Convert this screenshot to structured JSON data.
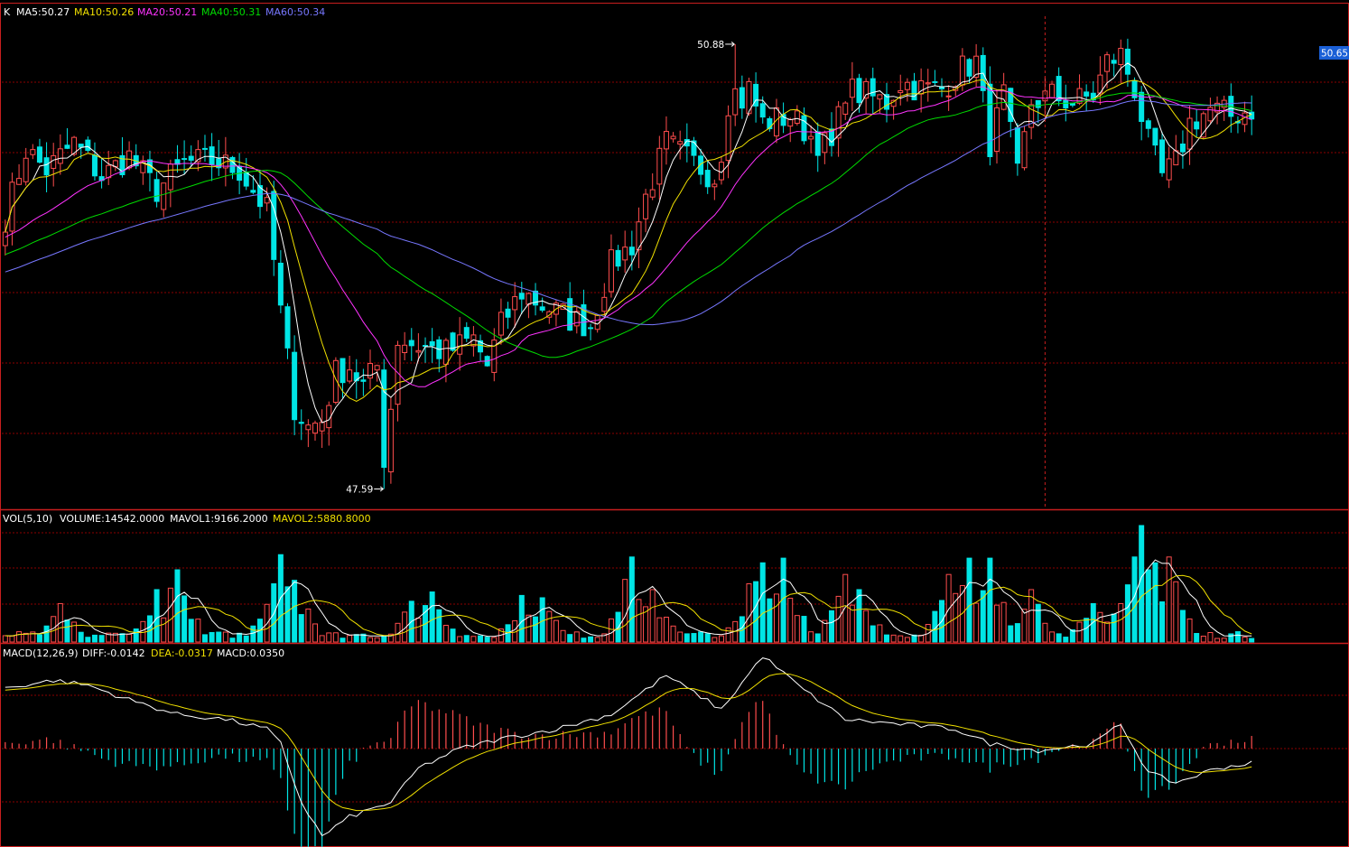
{
  "colors": {
    "up": "#ff4d4d",
    "down": "#00e5e5",
    "ma5": "#ffffff",
    "ma10": "#f0e000",
    "ma20": "#ff33ff",
    "ma40": "#00dd00",
    "ma60": "#7777ff",
    "grid": "#8b0000",
    "frame": "#c81e1e",
    "dea": "#f0e000",
    "diff": "#ffffff",
    "priceTagBg": "#1a5fd6"
  },
  "kline": {
    "prefix": "K",
    "ma5": "MA5:50.27",
    "ma10": "MA10:50.26",
    "ma20": "MA20:50.21",
    "ma40": "MA40:50.31",
    "ma60": "MA60:50.34",
    "high_label": "50.88",
    "low_label": "47.59",
    "price_tag": "50.65"
  },
  "volume": {
    "title": "VOL(5,10)",
    "volume": "VOLUME:14542.0000",
    "mavol1": "MAVOL1:9166.2000",
    "mavol2": "MAVOL2:5880.8000"
  },
  "macd": {
    "title": "MACD(12,26,9)",
    "diff": "DIFF:-0.0142",
    "dea": "DEA:-0.0317",
    "macd": "MACD:0.0350"
  },
  "chart_data": {
    "type": "candlestick",
    "price_range": [
      47.5,
      51.1
    ],
    "high": 50.88,
    "low": 47.59,
    "last": 50.65,
    "close_anchors": [
      [
        0,
        49.6
      ],
      [
        3,
        50.1
      ],
      [
        6,
        49.95
      ],
      [
        10,
        50.15
      ],
      [
        14,
        49.9
      ],
      [
        18,
        50.05
      ],
      [
        22,
        49.8
      ],
      [
        26,
        50.0
      ],
      [
        30,
        50.02
      ],
      [
        34,
        49.95
      ],
      [
        38,
        49.65
      ],
      [
        40,
        48.9
      ],
      [
        42,
        48.2
      ],
      [
        44,
        48.05
      ],
      [
        46,
        48.1
      ],
      [
        48,
        48.45
      ],
      [
        50,
        48.5
      ],
      [
        52,
        48.35
      ],
      [
        54,
        48.5
      ],
      [
        55,
        47.7
      ],
      [
        57,
        48.7
      ],
      [
        60,
        48.65
      ],
      [
        64,
        48.6
      ],
      [
        68,
        48.7
      ],
      [
        70,
        48.5
      ],
      [
        72,
        48.8
      ],
      [
        75,
        49.05
      ],
      [
        78,
        48.95
      ],
      [
        82,
        48.85
      ],
      [
        85,
        48.8
      ],
      [
        88,
        49.25
      ],
      [
        91,
        49.4
      ],
      [
        93,
        49.75
      ],
      [
        96,
        50.15
      ],
      [
        100,
        50.0
      ],
      [
        103,
        49.9
      ],
      [
        105,
        50.3
      ],
      [
        108,
        50.55
      ],
      [
        110,
        50.3
      ],
      [
        114,
        50.35
      ],
      [
        117,
        50.2
      ],
      [
        120,
        50.1
      ],
      [
        122,
        50.55
      ],
      [
        125,
        50.5
      ],
      [
        128,
        50.45
      ],
      [
        130,
        50.6
      ],
      [
        133,
        50.55
      ],
      [
        136,
        50.55
      ],
      [
        139,
        50.7
      ],
      [
        141,
        50.75
      ],
      [
        143,
        50.15
      ],
      [
        145,
        50.5
      ],
      [
        147,
        49.9
      ],
      [
        149,
        50.45
      ],
      [
        152,
        50.5
      ],
      [
        155,
        50.45
      ],
      [
        158,
        50.5
      ],
      [
        160,
        50.75
      ],
      [
        162,
        50.8
      ],
      [
        164,
        50.55
      ],
      [
        166,
        50.15
      ],
      [
        168,
        49.9
      ],
      [
        170,
        50.0
      ],
      [
        172,
        50.3
      ],
      [
        175,
        50.4
      ],
      [
        178,
        50.35
      ],
      [
        181,
        50.4
      ]
    ],
    "volume_spikes": [
      [
        8,
        0.33
      ],
      [
        22,
        0.45
      ],
      [
        25,
        0.62
      ],
      [
        39,
        0.5
      ],
      [
        40,
        0.75
      ],
      [
        42,
        0.53
      ],
      [
        59,
        0.35
      ],
      [
        62,
        0.43
      ],
      [
        75,
        0.4
      ],
      [
        78,
        0.38
      ],
      [
        91,
        0.73
      ],
      [
        94,
        0.45
      ],
      [
        108,
        0.5
      ],
      [
        110,
        0.68
      ],
      [
        113,
        0.72
      ],
      [
        122,
        0.58
      ],
      [
        124,
        0.45
      ],
      [
        137,
        0.58
      ],
      [
        140,
        0.72
      ],
      [
        143,
        0.72
      ],
      [
        149,
        0.45
      ],
      [
        158,
        0.33
      ],
      [
        162,
        0.33
      ],
      [
        165,
        1.0
      ],
      [
        167,
        0.68
      ],
      [
        169,
        0.73
      ]
    ],
    "macd_diff_anchors": [
      [
        0,
        0.62
      ],
      [
        7,
        0.7
      ],
      [
        12,
        0.65
      ],
      [
        18,
        0.5
      ],
      [
        25,
        0.35
      ],
      [
        32,
        0.3
      ],
      [
        38,
        0.2
      ],
      [
        40,
        0.05
      ],
      [
        43,
        -0.55
      ],
      [
        46,
        -0.9
      ],
      [
        50,
        -0.7
      ],
      [
        56,
        -0.55
      ],
      [
        60,
        -0.2
      ],
      [
        66,
        0.0
      ],
      [
        72,
        0.1
      ],
      [
        80,
        0.2
      ],
      [
        88,
        0.35
      ],
      [
        96,
        0.75
      ],
      [
        104,
        0.4
      ],
      [
        110,
        0.95
      ],
      [
        116,
        0.6
      ],
      [
        122,
        0.3
      ],
      [
        130,
        0.25
      ],
      [
        138,
        0.2
      ],
      [
        143,
        0.05
      ],
      [
        150,
        -0.02
      ],
      [
        158,
        0.05
      ],
      [
        162,
        0.25
      ],
      [
        166,
        -0.25
      ],
      [
        170,
        -0.35
      ],
      [
        176,
        -0.2
      ],
      [
        181,
        -0.15
      ]
    ]
  }
}
